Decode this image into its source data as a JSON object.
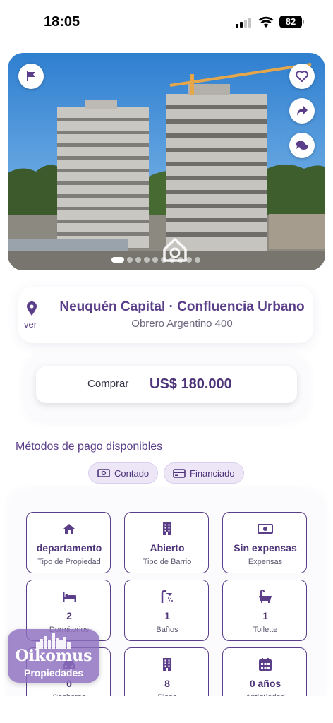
{
  "status_bar": {
    "time": "18:05",
    "battery": "82"
  },
  "hero": {
    "icons": [
      "flag-icon",
      "heart-icon",
      "share-icon",
      "chat-icon",
      "home-watermark-icon"
    ],
    "slide_count": 10,
    "active_slide": 1
  },
  "location": {
    "title": "Neuquén Capital · Confluencia Urbano",
    "address": "Obrero Argentino 400",
    "map_link": "ver"
  },
  "price": {
    "operation": "Comprar",
    "amount": "US$ 180.000"
  },
  "payment": {
    "title": "Métodos de pago disponibles",
    "methods": [
      {
        "label": "Contado",
        "icon": "cash-icon"
      },
      {
        "label": "Financiado",
        "icon": "card-icon"
      }
    ]
  },
  "features": [
    {
      "value": "departamento",
      "label": "Tipo de Propiedad",
      "icon": "home-icon"
    },
    {
      "value": "Abierto",
      "label": "Tipo de Barrio",
      "icon": "building-icon"
    },
    {
      "value": "Sin expensas",
      "label": "Expensas",
      "icon": "money-icon"
    },
    {
      "value": "2",
      "label": "Dormitorios",
      "icon": "bed-icon"
    },
    {
      "value": "1",
      "label": "Baños",
      "icon": "shower-icon"
    },
    {
      "value": "1",
      "label": "Toilette",
      "icon": "bathtub-icon"
    },
    {
      "value": "0",
      "label": "Cocheras",
      "icon": "car-icon"
    },
    {
      "value": "8",
      "label": "Pisos",
      "icon": "building-icon"
    },
    {
      "value": "0 años",
      "label": "Antigüedad",
      "icon": "calendar-icon"
    }
  ],
  "logo": {
    "brand": "Oikomus",
    "subtitle": "Propiedades"
  },
  "colors": {
    "accent": "#5a3e8a",
    "chip_bg": "#ece6f7",
    "sky": "#3f8fd6"
  }
}
